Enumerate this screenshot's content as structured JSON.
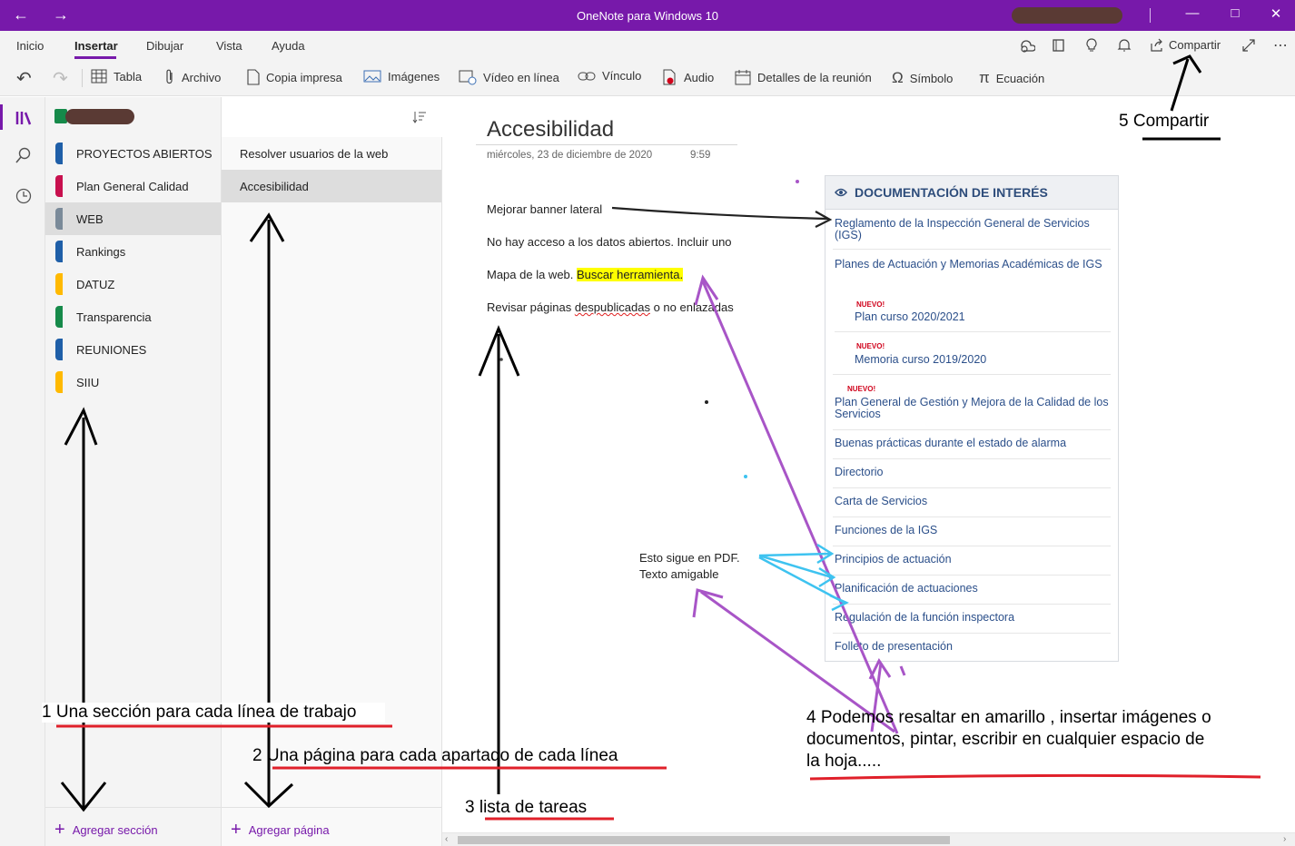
{
  "window": {
    "title": "OneNote para Windows 10"
  },
  "ribbon": {
    "tabs": [
      "Inicio",
      "Insertar",
      "Dibujar",
      "Vista",
      "Ayuda"
    ],
    "active_tab": "Insertar",
    "share_label": "Compartir",
    "commands": [
      "Tabla",
      "Archivo",
      "Copia impresa",
      "Imágenes",
      "Vídeo en línea",
      "Vínculo",
      "Audio",
      "Detalles de la reunión",
      "Símbolo",
      "Ecuación"
    ]
  },
  "sections": {
    "items": [
      {
        "label": "PROYECTOS ABIERTOS",
        "color": "#1f5fa8"
      },
      {
        "label": "Plan General Calidad",
        "color": "#c8104e"
      },
      {
        "label": "WEB",
        "color": "#7a8a99"
      },
      {
        "label": "Rankings",
        "color": "#1f5fa8"
      },
      {
        "label": "DATUZ",
        "color": "#ffb900"
      },
      {
        "label": "Transparencia",
        "color": "#168a4a"
      },
      {
        "label": "REUNIONES",
        "color": "#1f5fa8"
      },
      {
        "label": "SIIU",
        "color": "#ffb900"
      }
    ],
    "selected": "WEB",
    "add_label": "Agregar sección"
  },
  "pages": {
    "items": [
      "Resolver usuarios de la web",
      "Accesibilidad"
    ],
    "selected": "Accesibilidad",
    "add_label": "Agregar página"
  },
  "page": {
    "title": "Accesibilidad",
    "date": "miércoles, 23 de diciembre de 2020",
    "time": "9:59",
    "lines": {
      "l1": "Mejorar banner lateral",
      "l2": "No hay acceso a los datos abiertos. Incluir uno",
      "l3_pre": "Mapa de la web. ",
      "l3_hl": "Buscar herramienta.",
      "l4_pre": "Revisar páginas ",
      "l4_squig": "despublicadas",
      "l4_post": " o no enlazadas"
    },
    "side_note": [
      "Esto sigue en PDF.",
      "Texto amigable"
    ]
  },
  "doc_panel": {
    "heading": "DOCUMENTACIÓN DE INTERÉS",
    "badge": "NUEVO!",
    "links": [
      "Reglamento de la Inspección General de Servicios (IGS)",
      "Planes de Actuación y Memorias Académicas de IGS",
      "Plan curso 2020/2021",
      "Memoria curso 2019/2020",
      "Plan General de Gestión y Mejora de la Calidad de los Servicios",
      "Buenas prácticas durante el estado de alarma",
      "Directorio",
      "Carta de Servicios",
      "Funciones de la IGS",
      "Principios de actuación",
      "Planificación de actuaciones",
      "Regulación de la función inspectora",
      "Folleto de presentación"
    ]
  },
  "annotations": {
    "a1": "1 Una sección para cada línea de trabajo",
    "a2": "2 Una página para cada apartado de cada línea",
    "a3": "3 lista de tareas",
    "a4": [
      "4 Podemos resaltar en amarillo , insertar imágenes o",
      "documentos, pintar, escribir en cualquier espacio de",
      "la hoja....."
    ],
    "a5": "5 Compartir"
  },
  "colors": {
    "accent": "#7719aa",
    "highlight": "#ffff00",
    "link": "#2b4f8a",
    "annotation_purple": "#a855c7",
    "annotation_cyan": "#3ec3f0",
    "annotation_red": "#e0202a"
  }
}
